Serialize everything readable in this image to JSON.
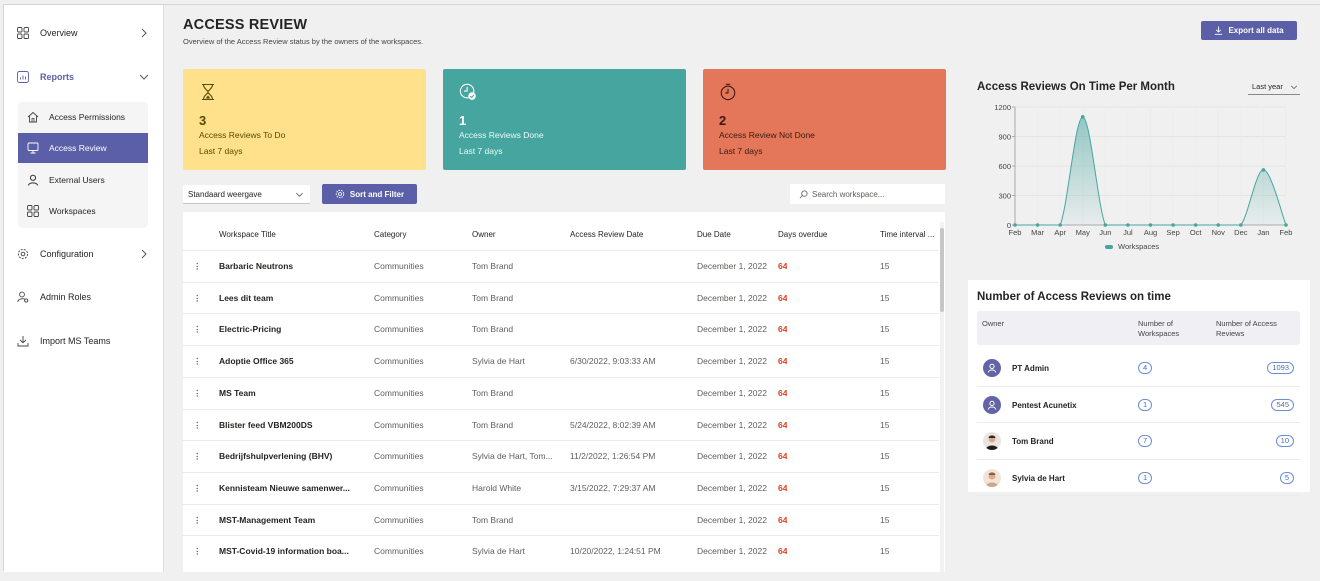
{
  "sidebar": {
    "items": [
      {
        "label": "Overview",
        "icon": "grid-icon"
      },
      {
        "label": "Reports",
        "icon": "report-icon"
      },
      {
        "label": "Configuration",
        "icon": "gear-icon"
      },
      {
        "label": "Admin Roles",
        "icon": "admin-roles-icon"
      },
      {
        "label": "Import MS Teams",
        "icon": "import-icon"
      }
    ],
    "sub_items": [
      {
        "label": "Access Permissions",
        "icon": "home-icon"
      },
      {
        "label": "Access Review",
        "icon": "monitor-icon"
      },
      {
        "label": "External Users",
        "icon": "person-icon"
      },
      {
        "label": "Workspaces",
        "icon": "grid-icon"
      }
    ]
  },
  "header": {
    "title": "ACCESS REVIEW",
    "subtitle": "Overview of the Access Review status by the owners of the workspaces.",
    "export_label": "Export all data"
  },
  "cards": [
    {
      "value": "3",
      "title": "Access Reviews To Do",
      "period": "Last 7 days",
      "icon": "hourglass-icon",
      "color": "#fee18a"
    },
    {
      "value": "1",
      "title": "Access Reviews Done",
      "period": "Last 7 days",
      "icon": "clock-check-icon",
      "color": "#47a59f"
    },
    {
      "value": "2",
      "title": "Access Review Not Done",
      "period": "Last 7 days",
      "icon": "timer-icon",
      "color": "#e4775a"
    }
  ],
  "toolbar": {
    "view_label": "Standaard weergave",
    "sort_label": "Sort and Filter",
    "search_placeholder": "Search workspace..."
  },
  "table": {
    "columns": [
      "Workspace Title",
      "Category",
      "Owner",
      "Access Review Date",
      "Due Date",
      "Days overdue",
      "Time interval ..."
    ],
    "rows": [
      [
        "Barbaric Neutrons",
        "Communities",
        "Tom Brand",
        "",
        "December 1, 2022",
        "64",
        "15"
      ],
      [
        "Lees dit team",
        "Communities",
        "Tom Brand",
        "",
        "December 1, 2022",
        "64",
        "15"
      ],
      [
        "Electric-Pricing",
        "Communities",
        "Tom Brand",
        "",
        "December 1, 2022",
        "64",
        "15"
      ],
      [
        "Adoptie Office 365",
        "Communities",
        "Sylvia de Hart",
        "6/30/2022, 9:03:33 AM",
        "December 1, 2022",
        "64",
        "15"
      ],
      [
        "MS Team",
        "Communities",
        "Tom Brand",
        "",
        "December 1, 2022",
        "64",
        "15"
      ],
      [
        "Blister feed VBM200DS",
        "Communities",
        "Tom Brand",
        "5/24/2022, 8:02:39 AM",
        "December 1, 2022",
        "64",
        "15"
      ],
      [
        "Bedrijfshulpverlening (BHV)",
        "Communities",
        "Sylvia de Hart, Tom...",
        "11/2/2022, 1:26:54 PM",
        "December 1, 2022",
        "64",
        "15"
      ],
      [
        "Kennisteam Nieuwe samenwer...",
        "Communities",
        "Harold White",
        "3/15/2022, 7:29:37 AM",
        "December 1, 2022",
        "64",
        "15"
      ],
      [
        "MST-Management Team",
        "Communities",
        "Tom Brand",
        "",
        "December 1, 2022",
        "64",
        "15"
      ],
      [
        "MST-Covid-19 information boa...",
        "Communities",
        "Sylvia de Hart",
        "10/20/2022, 1:24:51 PM",
        "December 1, 2022",
        "64",
        "15"
      ]
    ]
  },
  "chart": {
    "title": "Access Reviews On Time Per Month",
    "range_label": "Last year"
  },
  "chart_data": {
    "type": "area",
    "title": "Access Reviews On Time Per Month",
    "categories": [
      "Feb",
      "Mar",
      "Apr",
      "May",
      "Jun",
      "Jul",
      "Aug",
      "Sep",
      "Oct",
      "Nov",
      "Dec",
      "Jan",
      "Feb"
    ],
    "series": [
      {
        "name": "Workspaces",
        "values": [
          0,
          0,
          0,
          1100,
          0,
          0,
          0,
          0,
          0,
          0,
          0,
          560,
          0
        ]
      }
    ],
    "yticks": [
      "0",
      "300",
      "600",
      "900",
      "1200"
    ],
    "ylim": [
      0,
      1200
    ],
    "grid": true,
    "legend": "bottom",
    "color": "#47a59f"
  },
  "owners_table": {
    "title": "Number of Access Reviews on time",
    "columns": [
      "Owner",
      "Number of Workspaces",
      "Number of Access Reviews"
    ],
    "rows": [
      {
        "name": "PT Admin",
        "workspaces": "4",
        "reviews": "1093",
        "avatar": "default-avatar-icon"
      },
      {
        "name": "Pentest Acunetix",
        "workspaces": "1",
        "reviews": "545",
        "avatar": "default-avatar-icon"
      },
      {
        "name": "Tom Brand",
        "workspaces": "7",
        "reviews": "10",
        "avatar": "photo-avatar-icon"
      },
      {
        "name": "Sylvia de Hart",
        "workspaces": "1",
        "reviews": "5",
        "avatar": "photo-avatar-icon"
      }
    ]
  }
}
